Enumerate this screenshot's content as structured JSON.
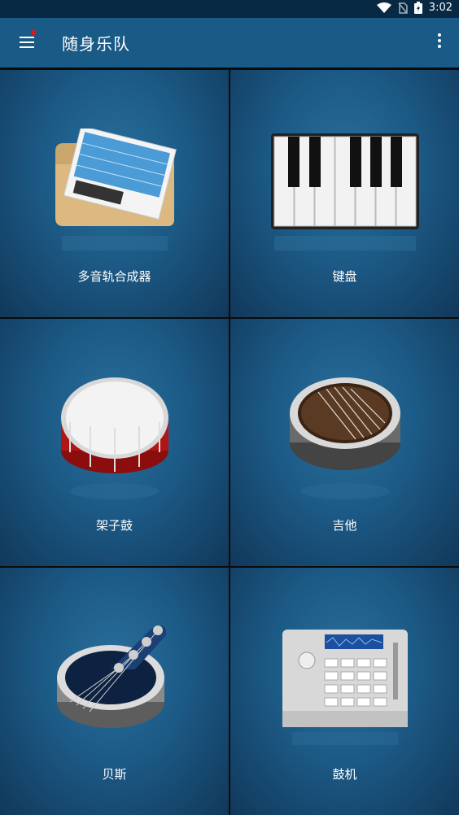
{
  "status_bar": {
    "time": "3:02"
  },
  "app_bar": {
    "title": "随身乐队"
  },
  "tiles": [
    {
      "label": "多音轨合成器",
      "icon": "multitrack-icon"
    },
    {
      "label": "键盘",
      "icon": "keyboard-icon"
    },
    {
      "label": "架子鼓",
      "icon": "drum-icon"
    },
    {
      "label": "吉他",
      "icon": "guitar-icon"
    },
    {
      "label": "贝斯",
      "icon": "bass-icon"
    },
    {
      "label": "鼓机",
      "icon": "drum-machine-icon"
    }
  ]
}
